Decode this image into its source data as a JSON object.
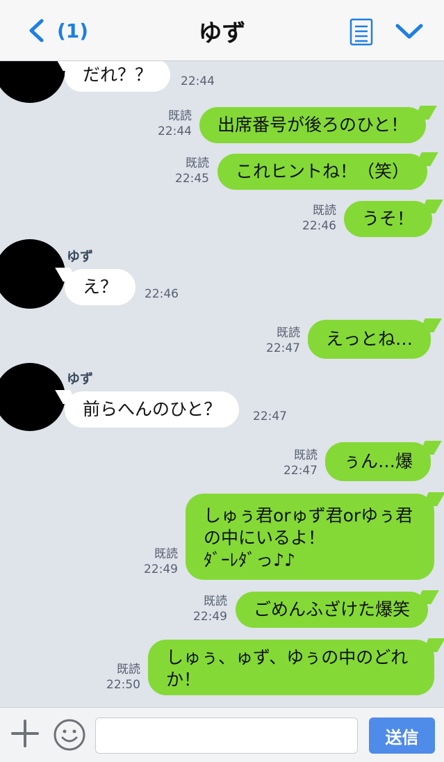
{
  "header": {
    "back_count": "(1)",
    "title": "ゆず"
  },
  "messages": [
    {
      "dir": "in",
      "text": "だれ？？",
      "time": "22:44"
    },
    {
      "dir": "out",
      "text": "出席番号が後ろのひと！",
      "read": "既読",
      "time": "22:44"
    },
    {
      "dir": "out",
      "text": "これヒントね！（笑）",
      "read": "既読",
      "time": "22:45"
    },
    {
      "dir": "out",
      "text": "うそ！",
      "read": "既読",
      "time": "22:46"
    },
    {
      "dir": "in",
      "sender": "ゆず",
      "text": "え？",
      "time": "22:46"
    },
    {
      "dir": "out",
      "text": "えっとね…",
      "read": "既読",
      "time": "22:47"
    },
    {
      "dir": "in",
      "sender": "ゆず",
      "text": "前らへんのひと？",
      "time": "22:47"
    },
    {
      "dir": "out",
      "text": "ぅん…爆",
      "read": "既読",
      "time": "22:47"
    },
    {
      "dir": "out",
      "text": "しゅぅ君orゅず君orゆぅ君\nの中にいるよ！\nﾀﾞｰﾚﾀﾞっ♪♪",
      "read": "既読",
      "time": "22:49"
    },
    {
      "dir": "out",
      "text": "ごめんふざけた爆笑",
      "read": "既読",
      "time": "22:49"
    },
    {
      "dir": "out",
      "text": "しゅぅ、ゅず、ゆぅの中のどれ\nか！",
      "read": "既読",
      "time": "22:50"
    }
  ],
  "input": {
    "placeholder": "",
    "send_label": "送信"
  }
}
